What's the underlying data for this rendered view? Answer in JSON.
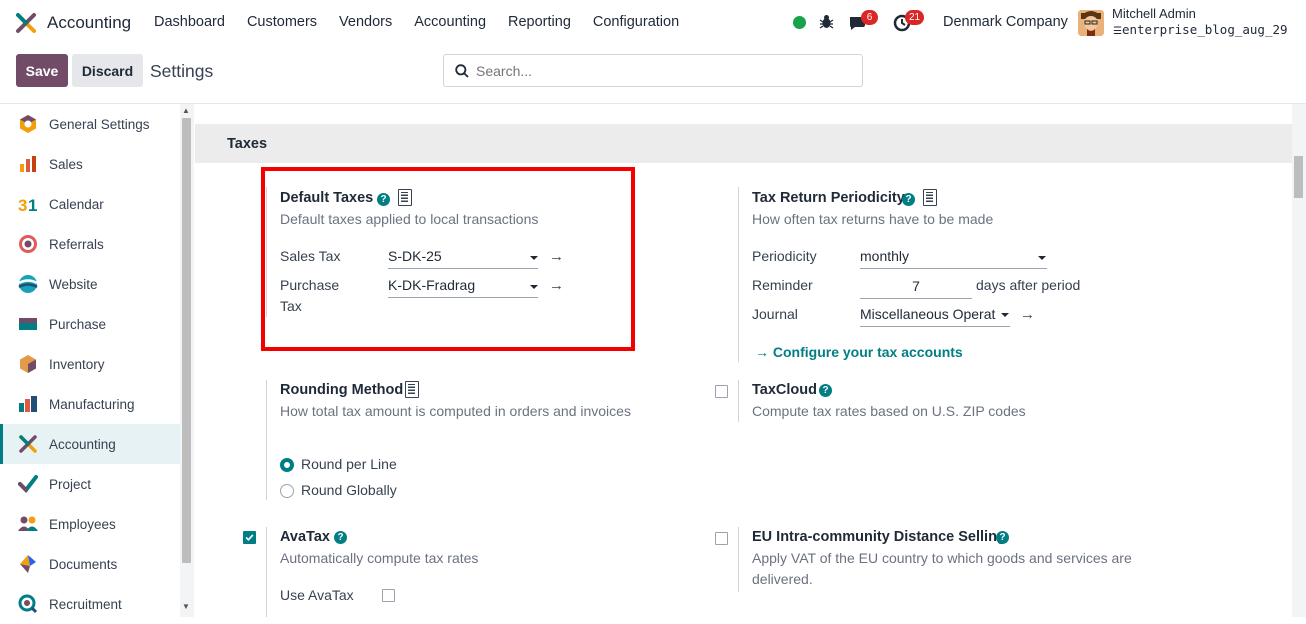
{
  "navbar": {
    "app_name": "Accounting",
    "menu": [
      "Dashboard",
      "Customers",
      "Vendors",
      "Accounting",
      "Reporting",
      "Configuration"
    ],
    "chat_badge": "6",
    "activity_badge": "21",
    "company": "Denmark Company",
    "user_name": "Mitchell Admin",
    "database": "enterprise_blog_aug_29"
  },
  "control": {
    "save_label": "Save",
    "discard_label": "Discard",
    "breadcrumb": "Settings",
    "search_placeholder": "Search..."
  },
  "sidebar": {
    "items": [
      {
        "label": "General Settings",
        "icon": "general-settings-icon"
      },
      {
        "label": "Sales",
        "icon": "sales-icon"
      },
      {
        "label": "Calendar",
        "icon": "calendar-icon"
      },
      {
        "label": "Referrals",
        "icon": "referrals-icon"
      },
      {
        "label": "Website",
        "icon": "website-icon"
      },
      {
        "label": "Purchase",
        "icon": "purchase-icon"
      },
      {
        "label": "Inventory",
        "icon": "inventory-icon"
      },
      {
        "label": "Manufacturing",
        "icon": "manufacturing-icon"
      },
      {
        "label": "Accounting",
        "icon": "accounting-icon",
        "active": true
      },
      {
        "label": "Project",
        "icon": "project-icon"
      },
      {
        "label": "Employees",
        "icon": "employees-icon"
      },
      {
        "label": "Documents",
        "icon": "documents-icon"
      },
      {
        "label": "Recruitment",
        "icon": "recruitment-icon"
      }
    ]
  },
  "section": {
    "title": "Taxes"
  },
  "default_taxes": {
    "title": "Default Taxes",
    "desc": "Default taxes applied to local transactions",
    "sales_tax_label": "Sales Tax",
    "sales_tax_value": "S-DK-25",
    "purchase_tax_label_1": "Purchase",
    "purchase_tax_label_2": "Tax",
    "purchase_tax_value": "K-DK-Fradrag"
  },
  "tax_return": {
    "title": "Tax Return Periodicity",
    "desc": "How often tax returns have to be made",
    "periodicity_label": "Periodicity",
    "periodicity_value": "monthly",
    "reminder_label": "Reminder",
    "reminder_value": "7",
    "reminder_suffix": "days after period",
    "journal_label": "Journal",
    "journal_value": "Miscellaneous Operat",
    "config_link": "Configure your tax accounts"
  },
  "rounding": {
    "title": "Rounding Method",
    "desc": "How total tax amount is computed in orders and invoices",
    "options": [
      "Round per Line",
      "Round Globally"
    ],
    "selected": "Round per Line"
  },
  "taxcloud": {
    "title": "TaxCloud",
    "desc": "Compute tax rates based on U.S. ZIP codes",
    "checked": false
  },
  "avatax": {
    "title": "AvaTax",
    "desc": "Automatically compute tax rates",
    "checked": true,
    "use_label": "Use AvaTax",
    "use_checked": false
  },
  "eu_distance": {
    "title": "EU Intra-community Distance Selling",
    "desc_1": "Apply VAT of the EU country to which goods and services are",
    "desc_2": "delivered.",
    "checked": false
  },
  "colors": {
    "brand": "#714b67",
    "accent": "#017e84",
    "highlight_box": "#f40000"
  }
}
